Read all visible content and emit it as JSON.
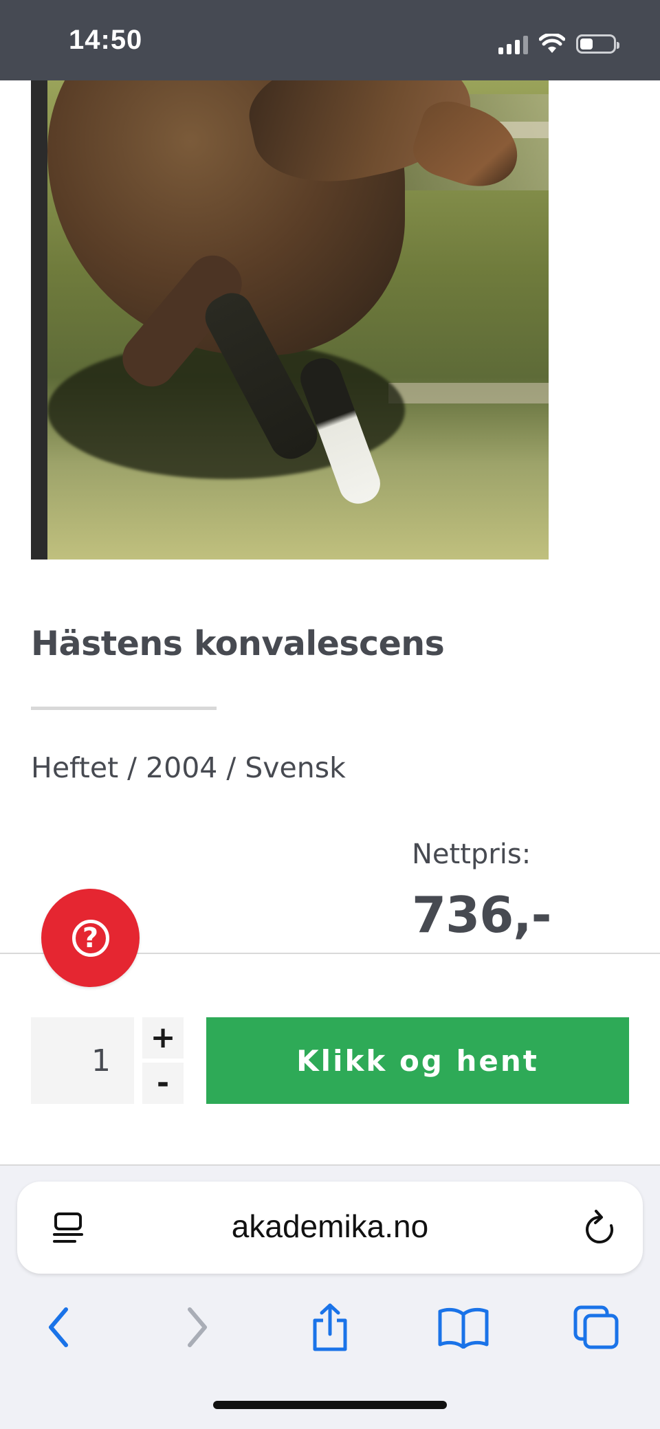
{
  "status_bar": {
    "time": "14:50"
  },
  "product": {
    "title": "Hästens konvalescens",
    "meta": "Heftet / 2004 / Svensk",
    "price_label": "Nettpris:",
    "price": "736,-"
  },
  "buy_bar": {
    "quantity": "1",
    "plus_label": "+",
    "minus_label": "-",
    "cta_label": "Klikk og hent"
  },
  "help": {
    "icon_glyph": "?"
  },
  "browser": {
    "url": "akademika.no"
  },
  "colors": {
    "status_bar_bg": "#464a53",
    "text": "#474a51",
    "help_red": "#e52631",
    "cta_green": "#2eaa57",
    "ios_blue": "#1a73e8"
  }
}
